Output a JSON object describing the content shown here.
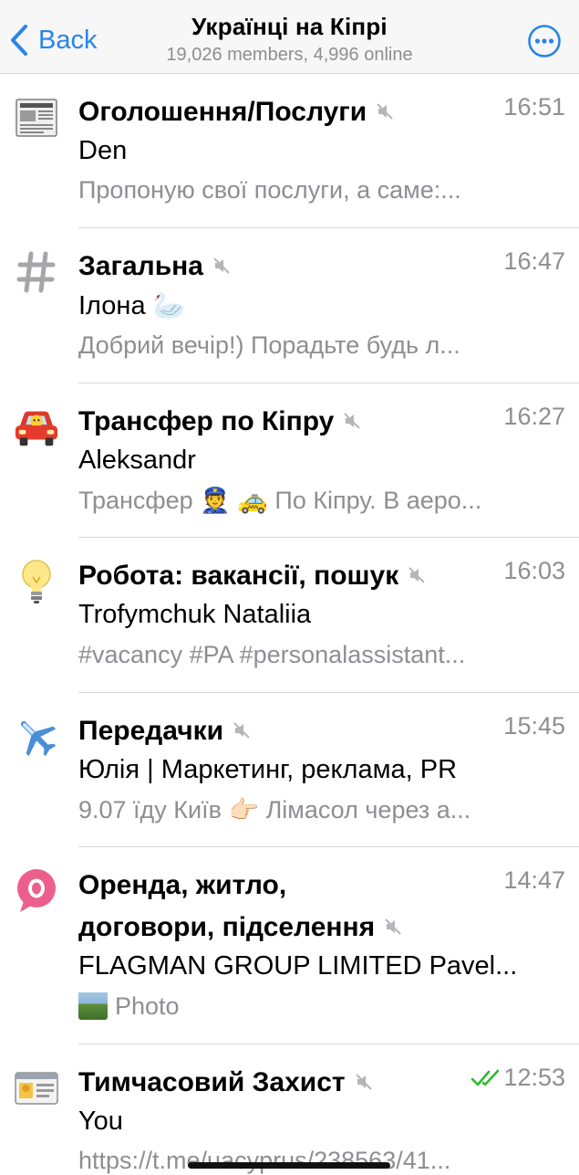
{
  "header": {
    "back_label": "Back",
    "title": "Українці на Кіпрі",
    "subtitle": "19,026 members, 4,996 online"
  },
  "colors": {
    "accent": "#2a85e8",
    "secondary_text": "#8e8e93",
    "read_check": "#2fb82f"
  },
  "chats": [
    {
      "icon": "newspaper-icon",
      "title": "Оголошення/Послуги",
      "muted": true,
      "time": "16:51",
      "sender": "Den",
      "preview": "Пропоную свої послуги, а саме:..."
    },
    {
      "icon": "hash-icon",
      "title": "Загальна",
      "muted": true,
      "time": "16:47",
      "sender": "Ілона 🦢",
      "preview": "Добрий вечір!) Порадьте будь л..."
    },
    {
      "icon": "taxi-car-icon",
      "title": "Трансфер по Кіпру",
      "muted": true,
      "time": "16:27",
      "sender": "Aleksandr",
      "preview": "Трансфер 👮 🚕 По Кіпру. В аеро..."
    },
    {
      "icon": "light-bulb-icon",
      "title": "Робота: вакансії, пошук",
      "muted": true,
      "time": "16:03",
      "sender": "Trofymchuk Nataliia",
      "preview": "#vacancy #PA #personalassistant..."
    },
    {
      "icon": "airplane-icon",
      "title": "Передачки",
      "muted": true,
      "time": "15:45",
      "sender": "Юлія | Маркетинг, реклама, PR",
      "preview": "9.07 їду Київ 👉🏻 Лімасол через а..."
    },
    {
      "icon": "speech-bubble-o-icon",
      "title_line1": "Оренда, житло,",
      "title_line2": "договори, підселення",
      "muted": true,
      "time": "14:47",
      "sender": "FLAGMAN GROUP LIMITED Pavel...",
      "preview": "Photo"
    },
    {
      "icon": "id-card-icon",
      "title": "Тимчасовий Захист",
      "muted": true,
      "time": "12:53",
      "read": true,
      "sender": "You",
      "preview": "https://t.me/uacyprus/238563/41..."
    }
  ]
}
